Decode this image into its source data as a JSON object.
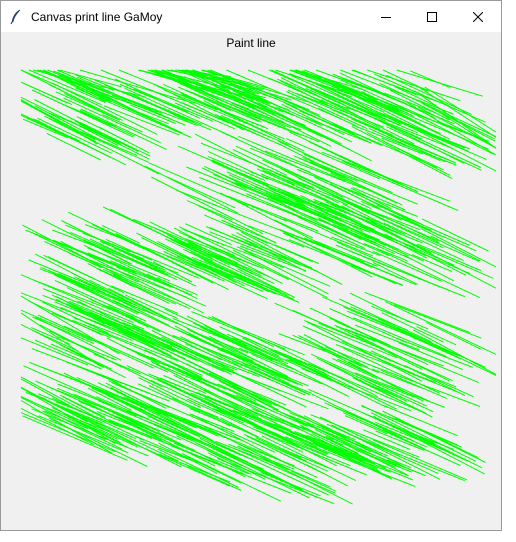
{
  "window": {
    "title": "Canvas print line GaMoy",
    "icon": "feather-icon",
    "controls": [
      "minimize-icon",
      "maximize-icon",
      "close-icon"
    ]
  },
  "canvas": {
    "heading": "Paint line",
    "background_color": "#f0f0f0",
    "line_color": "#00ff00"
  }
}
